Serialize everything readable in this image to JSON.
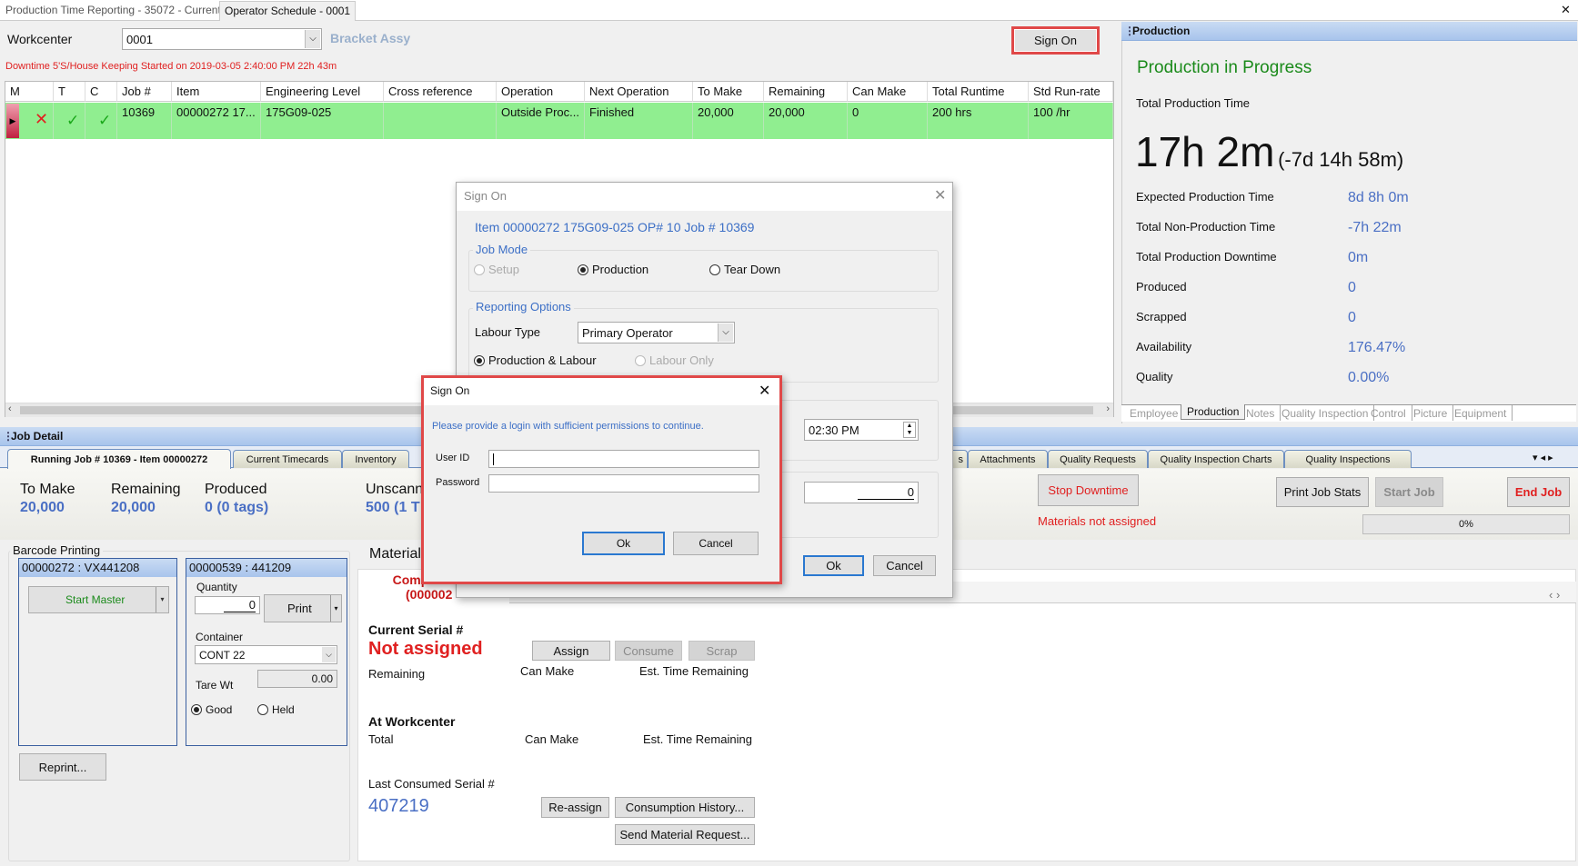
{
  "window_tabs": [
    "Production Time Reporting - 35072 - Current",
    "Operator Schedule - 0001"
  ],
  "close_glyph": "✕",
  "workcenter": {
    "label": "Workcenter",
    "value": "0001",
    "description": "Bracket Assy"
  },
  "sign_on_label": "Sign On",
  "downtime_text": "Downtime 5'S/House Keeping Started on 2019-03-05 2:40:00 PM 22h 43m",
  "grid": {
    "columns": [
      "M",
      "T",
      "C",
      "Job #",
      "Item",
      "Engineering Level",
      "Cross reference",
      "Operation",
      "Next Operation",
      "To Make",
      "Remaining",
      "Can Make",
      "Total Runtime",
      "Std Run-rate"
    ],
    "row": {
      "m": "✕",
      "t": "✓",
      "c": "✓",
      "job": "10369",
      "item": "00000272  17...",
      "eng": "175G09-025",
      "cross": "",
      "operation": "Outside  Proc...",
      "next": "Finished",
      "to_make": "20,000",
      "remaining": "20,000",
      "can_make": "0",
      "total_runtime": "200 hrs",
      "std_rate": "100 /hr"
    }
  },
  "production": {
    "header": "Production",
    "status": "Production in Progress",
    "total_label": "Total Production Time",
    "total_big": "17h 2m",
    "total_delta": "(-7d 14h 58m)",
    "rows": [
      {
        "label": "Expected Production Time",
        "value": "8d 8h 0m"
      },
      {
        "label": "Total Non-Production Time",
        "value": "-7h 22m"
      },
      {
        "label": "Total Production Downtime",
        "value": "0m"
      },
      {
        "label": "Produced",
        "value": "0"
      },
      {
        "label": "Scrapped",
        "value": "0"
      },
      {
        "label": "Availability",
        "value": "176.47%"
      },
      {
        "label": "Quality",
        "value": "0.00%"
      }
    ],
    "tabs": [
      "Employee",
      "Production",
      "Notes",
      "Quality Inspection",
      "Control",
      "Picture",
      "Equipment"
    ],
    "active_tab": "Production"
  },
  "job_detail": {
    "header": "Job Detail",
    "tabs": [
      "Running Job # 10369 - Item 00000272",
      "Current Timecards",
      "Inventory",
      "s",
      "Attachments",
      "Quality Requests",
      "Quality Inspection Charts",
      "Quality Inspections"
    ],
    "stats": [
      {
        "label": "To Make",
        "value": "20,000"
      },
      {
        "label": "Remaining",
        "value": "20,000"
      },
      {
        "label": "Produced",
        "value": "0 (0 tags)"
      },
      {
        "label": "Unscann",
        "value": "500 (1 T"
      }
    ],
    "stop_downtime": "Stop Downtime",
    "materials_status": "Materials not assigned",
    "print_job_stats": "Print Job Stats",
    "start_job": "Start Job",
    "end_job": "End Job",
    "progress": "0%",
    "progress_value": 0
  },
  "barcode": {
    "title": "Barcode Printing",
    "panel1_header": "00000272 : VX441208",
    "start_master": "Start Master",
    "panel2_header": "00000539 : 441209",
    "quantity_label": "Quantity",
    "quantity": "0",
    "print": "Print",
    "container_label": "Container",
    "container": "CONT 22",
    "tare_label": "Tare Wt",
    "tare": "0.00",
    "good": "Good",
    "held": "Held",
    "reprint": "Reprint..."
  },
  "material": {
    "title": "Material",
    "component_line1": "Compo",
    "component_line2": "(000002",
    "current_serial_label": "Current Serial #",
    "current_serial": "Not assigned",
    "assign": "Assign",
    "consume": "Consume",
    "scrap": "Scrap",
    "remaining": "Remaining",
    "can_make": "Can Make",
    "est_time": "Est. Time Remaining",
    "at_workcenter": "At Workcenter",
    "total": "Total",
    "last_consumed_label": "Last Consumed Serial #",
    "last_consumed": "407219",
    "reassign": "Re-assign",
    "history": "Consumption History...",
    "send_request": "Send Material Request..."
  },
  "sign_on_dialog": {
    "title": "Sign On",
    "item_line": "Item  00000272  175G09-025  OP#  10  Job #  10369",
    "job_mode": "Job Mode",
    "modes": [
      "Setup",
      "Production",
      "Tear Down"
    ],
    "selected_mode": "Production",
    "reporting_options": "Reporting Options",
    "labour_type_label": "Labour Type",
    "labour_type": "Primary Operator",
    "prod_labour": "Production & Labour",
    "labour_only": "Labour Only",
    "time": "02:30 PM",
    "qty": "0",
    "ok": "Ok",
    "cancel": "Cancel"
  },
  "login_dialog": {
    "title": "Sign On",
    "message": "Please provide a login with sufficient permissions to continue.",
    "user_id_label": "User ID",
    "user_id": "",
    "password_label": "Password",
    "password": "",
    "ok": "Ok",
    "cancel": "Cancel"
  },
  "colors": {
    "accent_blue": "#4a6fc4",
    "error_red": "#e02020",
    "success_green": "#1a8a1a",
    "row_green": "#90ee90",
    "highlight_red": "#e04848"
  }
}
